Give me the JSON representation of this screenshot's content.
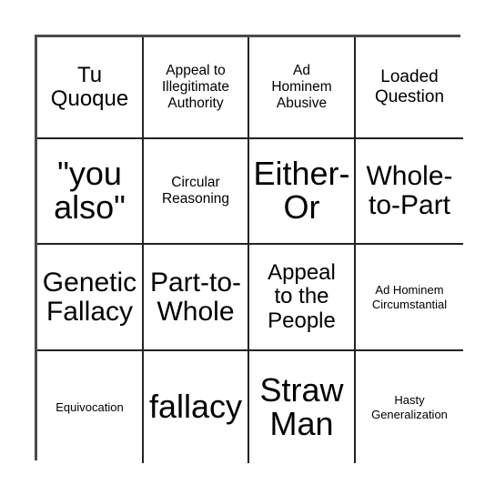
{
  "card": {
    "type": "bingo-card",
    "rows": 4,
    "columns": 4,
    "border_color": "#4a4a4a",
    "grid_line_color": "#222222",
    "background_color": "#ffffff",
    "text_color": "#000000",
    "cells": [
      {
        "text": "Tu\nQuoque",
        "size": "l"
      },
      {
        "text": "Appeal to\nIllegitimate\nAuthority",
        "size": "s"
      },
      {
        "text": "Ad\nHominem\nAbusive",
        "size": "s"
      },
      {
        "text": "Loaded\nQuestion",
        "size": "m"
      },
      {
        "text": "\"you\nalso\"",
        "size": "xxl"
      },
      {
        "text": "Circular\nReasoning",
        "size": "s"
      },
      {
        "text": "Either-\nOr",
        "size": "xxl"
      },
      {
        "text": "Whole-\nto-Part",
        "size": "xl"
      },
      {
        "text": "Genetic\nFallacy",
        "size": "xl"
      },
      {
        "text": "Part-to-\nWhole",
        "size": "xl"
      },
      {
        "text": "Appeal\nto the\nPeople",
        "size": "l"
      },
      {
        "text": "Ad Hominem\nCircumstantial",
        "size": "xs"
      },
      {
        "text": "Equivocation",
        "size": "xs"
      },
      {
        "text": "fallacy",
        "size": "xxl"
      },
      {
        "text": "Straw\nMan",
        "size": "xxl"
      },
      {
        "text": "Hasty\nGeneralization",
        "size": "xs"
      }
    ]
  }
}
